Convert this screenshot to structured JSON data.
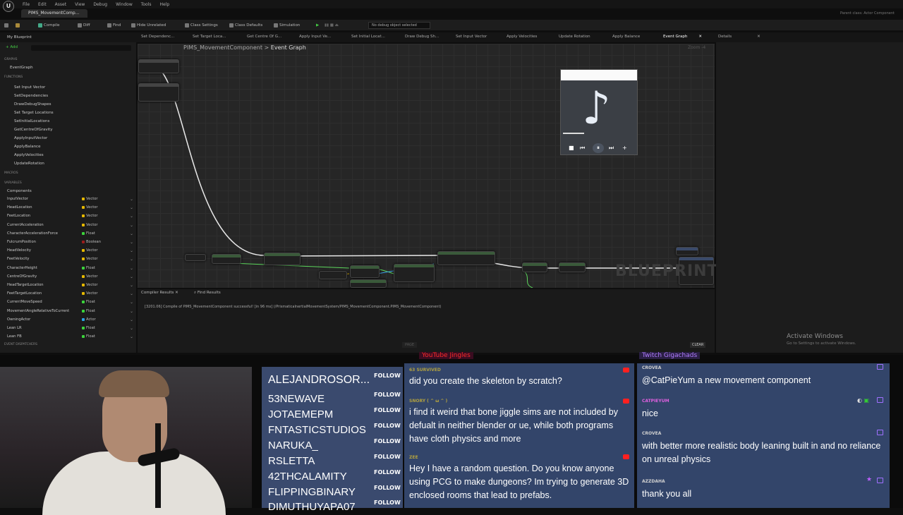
{
  "menu": {
    "items": [
      "File",
      "Edit",
      "Asset",
      "View",
      "Debug",
      "Window",
      "Tools",
      "Help"
    ]
  },
  "window_tab": "PIMS_MovementComp...",
  "parent_class": "Parent class: Actor Component",
  "toolbar": {
    "compile": "Compile",
    "diff": "Diff",
    "find": "Find",
    "hide_unrelated": "Hide Unrelated",
    "class_settings": "Class Settings",
    "class_defaults": "Class Defaults",
    "simulation": "Simulation",
    "debug_select": "No debug object selected"
  },
  "function_tabs": [
    "Set Dependenc...",
    "Set Target Loca...",
    "Get Centre Of G...",
    "Apply Input Ve...",
    "Set Initial Locat...",
    "Draw Debug Sh...",
    "Set Input Vector",
    "Apply Velocities",
    "Update Rotation",
    "Apply Balance",
    "Event Graph",
    "Details"
  ],
  "my_blueprint": {
    "title": "My Blueprint",
    "add": "+ Add",
    "graphs_header": "GRAPHS",
    "event_graph": "EventGraph",
    "functions_header": "FUNCTIONS",
    "functions": [
      "Set Input Vector",
      "SetDependencies",
      "DrawDebugShapes",
      "Set Target Locations",
      "SetInitialLocations",
      "GetCentreOfGravity",
      "ApplyInputVector",
      "ApplyBalance",
      "ApplyVelocities",
      "UpdateRotation"
    ],
    "macros_header": "MACROS",
    "variables_header": "VARIABLES",
    "components_header": "Components",
    "variables": [
      {
        "name": "InputVector",
        "type": "Vector"
      },
      {
        "name": "HeadLocation",
        "type": "Vector"
      },
      {
        "name": "FeetLocation",
        "type": "Vector"
      },
      {
        "name": "CurrentAcceleration",
        "type": "Vector"
      },
      {
        "name": "CharacterAccelerationForce",
        "type": "Float"
      },
      {
        "name": "FulcrumPosition",
        "type": "Boolean"
      },
      {
        "name": "HeadVelocity",
        "type": "Vector"
      },
      {
        "name": "FeetVelocity",
        "type": "Vector"
      },
      {
        "name": "CharacterHeight",
        "type": "Float"
      },
      {
        "name": "CentreOfGravity",
        "type": "Vector"
      },
      {
        "name": "HeadTargetLocation",
        "type": "Vector"
      },
      {
        "name": "FeetTargetLocation",
        "type": "Vector"
      },
      {
        "name": "CurrentMoveSpeed",
        "type": "Float"
      },
      {
        "name": "MovementAngleRelativeToCurrent",
        "type": "Float"
      },
      {
        "name": "OwningActor",
        "type": "Actor"
      },
      {
        "name": "Lean LR",
        "type": "Float"
      },
      {
        "name": "Lean FB",
        "type": "Float"
      }
    ],
    "event_dispatchers_header": "EVENT DISPATCHERS"
  },
  "graph": {
    "breadcrumb_root": "PIMS_MovementComponent",
    "breadcrumb_sep": ">",
    "breadcrumb_current": "Event Graph",
    "zoom": "Zoom -4",
    "watermark": "BLUEPRINT"
  },
  "compiler": {
    "tab_results": "Compiler Results",
    "tab_find": "Find Results",
    "message": "[3201.06] Compile of PIMS_MovementComponent successful! [in 96 ms] (/PrismaticaInertialMovementSystem/PIMS_MovementComponent.PIMS_MovementComponent)",
    "page": "PAGE",
    "clear": "CLEAR"
  },
  "details_tab": "Details",
  "activate_windows": {
    "title": "Activate Windows",
    "subtitle": "Go to Settings to activate Windows."
  },
  "follows": {
    "names": [
      "ALEJANDROSOR...",
      "53NEWAVE",
      "JOTAEMEPM",
      "FNTASTICSTUDIOS",
      "NARUKA_",
      "RSLETTA",
      "42THCALAMITY",
      "FLIPPINGBINARY",
      "DIMUTHUYAPA07"
    ],
    "follow_label": "FOLLOW"
  },
  "youtube": {
    "header": "YouTube Jingles",
    "messages": [
      {
        "user": "63 SURVIVED",
        "text": "did you create the skeleton by scratch?"
      },
      {
        "user": "SNORY ( ^ ω ^ )",
        "text": "i find it weird that bone jiggle sims are not included by defualt in neither blender or ue, while both programs have cloth physics and more"
      },
      {
        "user": "ZEE",
        "text": "Hey I have a random question. Do you know anyone using PCG to make dungeons? Im trying to generate 3D enclosed rooms that lead to prefabs."
      }
    ]
  },
  "twitch": {
    "header": "Twitch Gigachads",
    "messages": [
      {
        "user": "CROVEA",
        "text": "@CatPieYum a new movement component"
      },
      {
        "user": "CATPIEYUM",
        "text": "nice"
      },
      {
        "user": "CROVEA",
        "text": "with better more realistic body leaning built in and no reliance on unreal physics"
      },
      {
        "user": "AZZDAHA",
        "text": "thank you all"
      }
    ]
  },
  "colors": {
    "vector": "#e6b800",
    "float": "#3bd33b",
    "boolean": "#9a1c1c",
    "actor": "#2aa1e6",
    "youtube": "#ff2a2a",
    "twitch": "#b07cff",
    "panel_blue": "#33456a"
  }
}
